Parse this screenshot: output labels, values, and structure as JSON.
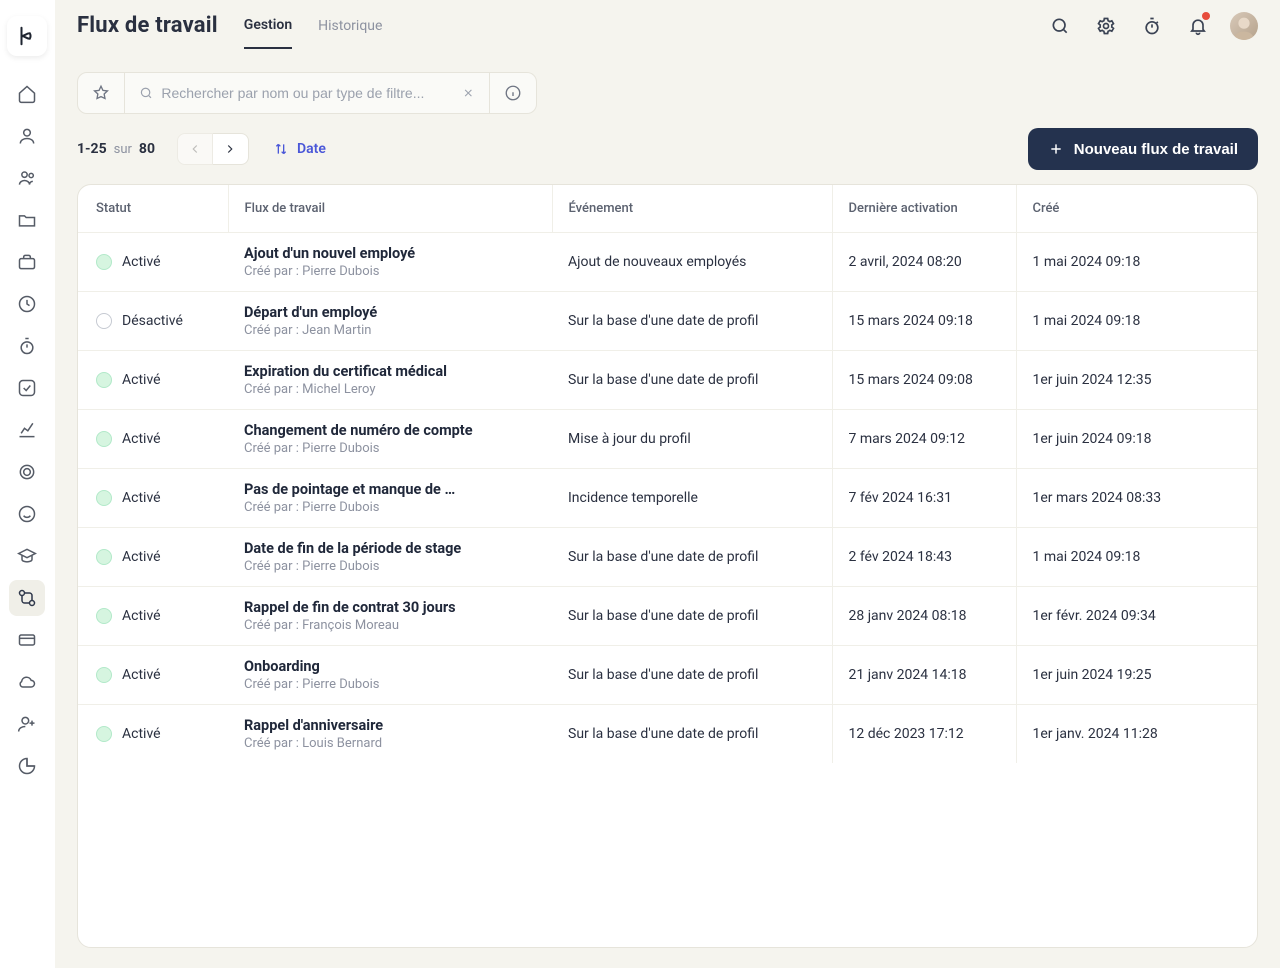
{
  "header": {
    "title": "Flux de travail",
    "tabs": [
      {
        "label": "Gestion",
        "active": true
      },
      {
        "label": "Historique",
        "active": false
      }
    ]
  },
  "search": {
    "placeholder": "Rechercher par nom ou par type de filtre..."
  },
  "pagination": {
    "range": "1-25",
    "sur": "sur",
    "total": "80"
  },
  "sort": {
    "label": "Date"
  },
  "primary_button": {
    "label": "Nouveau flux de travail"
  },
  "columns": {
    "status": "Statut",
    "flow": "Flux de travail",
    "event": "Événement",
    "last": "Dernière activation",
    "created": "Créé"
  },
  "status_labels": {
    "active": "Activé",
    "inactive": "Désactivé"
  },
  "created_prefix": "Créé par : ",
  "rows": [
    {
      "status": "active",
      "title": "Ajout d'un nouvel employé",
      "creator": "Pierre Dubois",
      "event": "Ajout de nouveaux employés",
      "last": "2 avril, 2024 08:20",
      "created": "1 mai 2024 09:18"
    },
    {
      "status": "inactive",
      "title": "Départ d'un employé",
      "creator": "Jean Martin",
      "event": "Sur la base d'une date de profil",
      "last": "15 mars 2024 09:18",
      "created": "1 mai 2024 09:18"
    },
    {
      "status": "active",
      "title": "Expiration du certificat médical",
      "creator": "Michel Leroy",
      "event": "Sur la base d'une date de profil",
      "last": "15 mars 2024 09:08",
      "created": "1er juin 2024 12:35"
    },
    {
      "status": "active",
      "title": "Changement de numéro de compte",
      "creator": "Pierre Dubois",
      "event": "Mise à jour du profil",
      "last": "7 mars 2024 09:12",
      "created": "1er juin 2024 09:18"
    },
    {
      "status": "active",
      "title": "Pas de pointage et manque de …",
      "creator": "Pierre Dubois",
      "event": "Incidence temporelle",
      "last": "7 fév 2024 16:31",
      "created": "1er mars 2024 08:33"
    },
    {
      "status": "active",
      "title": "Date de fin de la période de stage",
      "creator": "Pierre Dubois",
      "event": "Sur la base d'une date de profil",
      "last": "2 fév 2024 18:43",
      "created": "1 mai 2024 09:18"
    },
    {
      "status": "active",
      "title": "Rappel de fin de contrat 30 jours",
      "creator": "François Moreau",
      "event": "Sur la base d'une date de profil",
      "last": "28 janv 2024 08:18",
      "created": "1er févr. 2024 09:34"
    },
    {
      "status": "active",
      "title": "Onboarding",
      "creator": "Pierre Dubois",
      "event": "Sur la base d'une date de profil",
      "last": "21 janv 2024 14:18",
      "created": "1er juin 2024 19:25"
    },
    {
      "status": "active",
      "title": "Rappel d'anniversaire",
      "creator": "Louis Bernard",
      "event": "Sur la base d'une date de profil",
      "last": "12 déc 2023 17:12",
      "created": "1er janv. 2024 11:28"
    }
  ]
}
